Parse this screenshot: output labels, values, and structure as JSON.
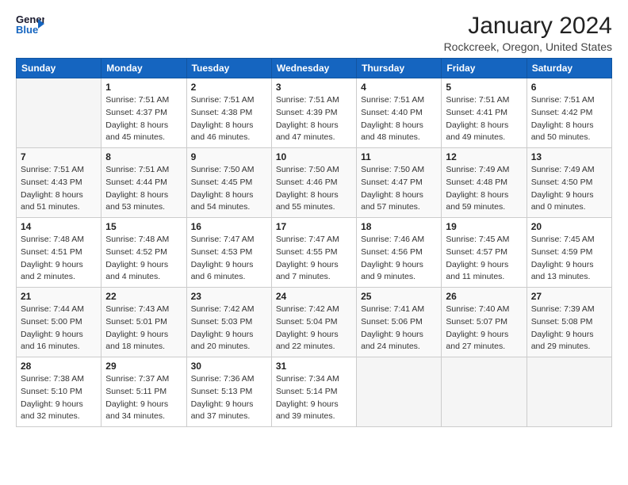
{
  "logo": {
    "line1": "General",
    "line2": "Blue"
  },
  "title": "January 2024",
  "subtitle": "Rockcreek, Oregon, United States",
  "days_header": [
    "Sunday",
    "Monday",
    "Tuesday",
    "Wednesday",
    "Thursday",
    "Friday",
    "Saturday"
  ],
  "weeks": [
    [
      {
        "num": "",
        "sunrise": "",
        "sunset": "",
        "daylight": ""
      },
      {
        "num": "1",
        "sunrise": "Sunrise: 7:51 AM",
        "sunset": "Sunset: 4:37 PM",
        "daylight": "Daylight: 8 hours and 45 minutes."
      },
      {
        "num": "2",
        "sunrise": "Sunrise: 7:51 AM",
        "sunset": "Sunset: 4:38 PM",
        "daylight": "Daylight: 8 hours and 46 minutes."
      },
      {
        "num": "3",
        "sunrise": "Sunrise: 7:51 AM",
        "sunset": "Sunset: 4:39 PM",
        "daylight": "Daylight: 8 hours and 47 minutes."
      },
      {
        "num": "4",
        "sunrise": "Sunrise: 7:51 AM",
        "sunset": "Sunset: 4:40 PM",
        "daylight": "Daylight: 8 hours and 48 minutes."
      },
      {
        "num": "5",
        "sunrise": "Sunrise: 7:51 AM",
        "sunset": "Sunset: 4:41 PM",
        "daylight": "Daylight: 8 hours and 49 minutes."
      },
      {
        "num": "6",
        "sunrise": "Sunrise: 7:51 AM",
        "sunset": "Sunset: 4:42 PM",
        "daylight": "Daylight: 8 hours and 50 minutes."
      }
    ],
    [
      {
        "num": "7",
        "sunrise": "Sunrise: 7:51 AM",
        "sunset": "Sunset: 4:43 PM",
        "daylight": "Daylight: 8 hours and 51 minutes."
      },
      {
        "num": "8",
        "sunrise": "Sunrise: 7:51 AM",
        "sunset": "Sunset: 4:44 PM",
        "daylight": "Daylight: 8 hours and 53 minutes."
      },
      {
        "num": "9",
        "sunrise": "Sunrise: 7:50 AM",
        "sunset": "Sunset: 4:45 PM",
        "daylight": "Daylight: 8 hours and 54 minutes."
      },
      {
        "num": "10",
        "sunrise": "Sunrise: 7:50 AM",
        "sunset": "Sunset: 4:46 PM",
        "daylight": "Daylight: 8 hours and 55 minutes."
      },
      {
        "num": "11",
        "sunrise": "Sunrise: 7:50 AM",
        "sunset": "Sunset: 4:47 PM",
        "daylight": "Daylight: 8 hours and 57 minutes."
      },
      {
        "num": "12",
        "sunrise": "Sunrise: 7:49 AM",
        "sunset": "Sunset: 4:48 PM",
        "daylight": "Daylight: 8 hours and 59 minutes."
      },
      {
        "num": "13",
        "sunrise": "Sunrise: 7:49 AM",
        "sunset": "Sunset: 4:50 PM",
        "daylight": "Daylight: 9 hours and 0 minutes."
      }
    ],
    [
      {
        "num": "14",
        "sunrise": "Sunrise: 7:48 AM",
        "sunset": "Sunset: 4:51 PM",
        "daylight": "Daylight: 9 hours and 2 minutes."
      },
      {
        "num": "15",
        "sunrise": "Sunrise: 7:48 AM",
        "sunset": "Sunset: 4:52 PM",
        "daylight": "Daylight: 9 hours and 4 minutes."
      },
      {
        "num": "16",
        "sunrise": "Sunrise: 7:47 AM",
        "sunset": "Sunset: 4:53 PM",
        "daylight": "Daylight: 9 hours and 6 minutes."
      },
      {
        "num": "17",
        "sunrise": "Sunrise: 7:47 AM",
        "sunset": "Sunset: 4:55 PM",
        "daylight": "Daylight: 9 hours and 7 minutes."
      },
      {
        "num": "18",
        "sunrise": "Sunrise: 7:46 AM",
        "sunset": "Sunset: 4:56 PM",
        "daylight": "Daylight: 9 hours and 9 minutes."
      },
      {
        "num": "19",
        "sunrise": "Sunrise: 7:45 AM",
        "sunset": "Sunset: 4:57 PM",
        "daylight": "Daylight: 9 hours and 11 minutes."
      },
      {
        "num": "20",
        "sunrise": "Sunrise: 7:45 AM",
        "sunset": "Sunset: 4:59 PM",
        "daylight": "Daylight: 9 hours and 13 minutes."
      }
    ],
    [
      {
        "num": "21",
        "sunrise": "Sunrise: 7:44 AM",
        "sunset": "Sunset: 5:00 PM",
        "daylight": "Daylight: 9 hours and 16 minutes."
      },
      {
        "num": "22",
        "sunrise": "Sunrise: 7:43 AM",
        "sunset": "Sunset: 5:01 PM",
        "daylight": "Daylight: 9 hours and 18 minutes."
      },
      {
        "num": "23",
        "sunrise": "Sunrise: 7:42 AM",
        "sunset": "Sunset: 5:03 PM",
        "daylight": "Daylight: 9 hours and 20 minutes."
      },
      {
        "num": "24",
        "sunrise": "Sunrise: 7:42 AM",
        "sunset": "Sunset: 5:04 PM",
        "daylight": "Daylight: 9 hours and 22 minutes."
      },
      {
        "num": "25",
        "sunrise": "Sunrise: 7:41 AM",
        "sunset": "Sunset: 5:06 PM",
        "daylight": "Daylight: 9 hours and 24 minutes."
      },
      {
        "num": "26",
        "sunrise": "Sunrise: 7:40 AM",
        "sunset": "Sunset: 5:07 PM",
        "daylight": "Daylight: 9 hours and 27 minutes."
      },
      {
        "num": "27",
        "sunrise": "Sunrise: 7:39 AM",
        "sunset": "Sunset: 5:08 PM",
        "daylight": "Daylight: 9 hours and 29 minutes."
      }
    ],
    [
      {
        "num": "28",
        "sunrise": "Sunrise: 7:38 AM",
        "sunset": "Sunset: 5:10 PM",
        "daylight": "Daylight: 9 hours and 32 minutes."
      },
      {
        "num": "29",
        "sunrise": "Sunrise: 7:37 AM",
        "sunset": "Sunset: 5:11 PM",
        "daylight": "Daylight: 9 hours and 34 minutes."
      },
      {
        "num": "30",
        "sunrise": "Sunrise: 7:36 AM",
        "sunset": "Sunset: 5:13 PM",
        "daylight": "Daylight: 9 hours and 37 minutes."
      },
      {
        "num": "31",
        "sunrise": "Sunrise: 7:34 AM",
        "sunset": "Sunset: 5:14 PM",
        "daylight": "Daylight: 9 hours and 39 minutes."
      },
      {
        "num": "",
        "sunrise": "",
        "sunset": "",
        "daylight": ""
      },
      {
        "num": "",
        "sunrise": "",
        "sunset": "",
        "daylight": ""
      },
      {
        "num": "",
        "sunrise": "",
        "sunset": "",
        "daylight": ""
      }
    ]
  ]
}
